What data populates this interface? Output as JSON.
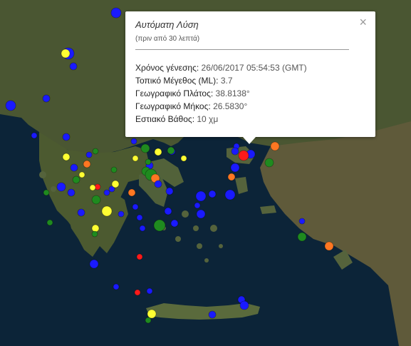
{
  "popup": {
    "title": "Αυτόματη Λύση",
    "subtitle": "(πριν από 30 λεπτά)",
    "close_glyph": "×",
    "rows": [
      {
        "label": "Χρόνος γένεσης:",
        "value": "26/06/2017  05:54:53 (GMT)"
      },
      {
        "label": "Τοπικό Μέγεθος (ML):",
        "value": "3.7"
      },
      {
        "label": "Γεωγραφικό Πλάτος:",
        "value": "38.8138°"
      },
      {
        "label": "Γεωγραφικό Μήκος:",
        "value": "26.5830°"
      },
      {
        "label": "Εστιακό Βάθος:",
        "value": "10 χμ"
      }
    ]
  },
  "map": {
    "sea_color": "#0b2236",
    "land_color": "#4e5a34",
    "marker_colors": {
      "blue": "#1a1aff",
      "yellow": "#ffff33",
      "green": "#1f8a1f",
      "orange": "#ff7722",
      "red": "#ff1a1a"
    }
  }
}
